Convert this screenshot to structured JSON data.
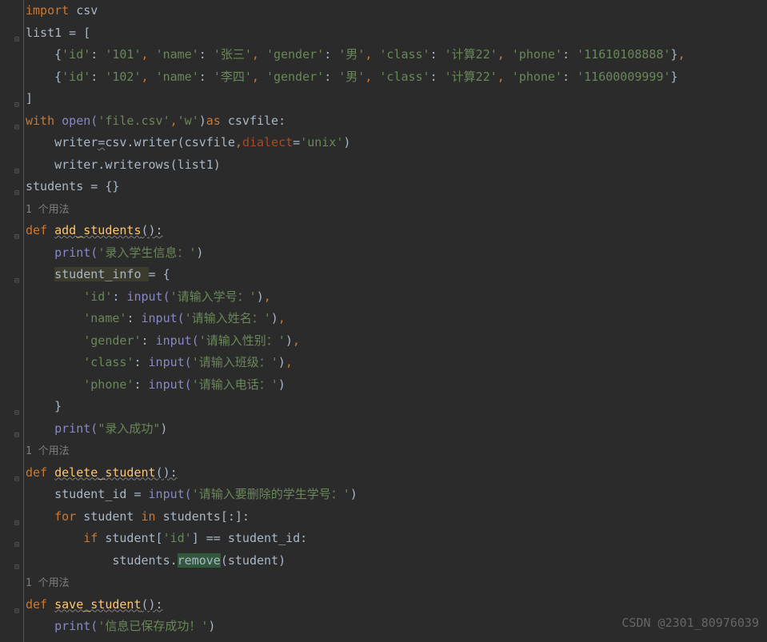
{
  "lines": [
    {
      "indent": 0,
      "segments": [
        {
          "t": "import ",
          "c": "kw"
        },
        {
          "t": "csv",
          "c": "fn"
        }
      ]
    },
    {
      "indent": 0,
      "segments": [
        {
          "t": "list1 = [",
          "c": "fn"
        }
      ]
    },
    {
      "indent": 1,
      "segments": [
        {
          "t": "{",
          "c": "fn"
        },
        {
          "t": "'id'",
          "c": "str"
        },
        {
          "t": ": ",
          "c": "fn"
        },
        {
          "t": "'101'",
          "c": "str"
        },
        {
          "t": ", ",
          "c": "kw"
        },
        {
          "t": "'name'",
          "c": "str"
        },
        {
          "t": ": ",
          "c": "fn"
        },
        {
          "t": "'张三'",
          "c": "str"
        },
        {
          "t": ", ",
          "c": "kw"
        },
        {
          "t": "'gender'",
          "c": "str"
        },
        {
          "t": ": ",
          "c": "fn"
        },
        {
          "t": "'男'",
          "c": "str"
        },
        {
          "t": ", ",
          "c": "kw"
        },
        {
          "t": "'class'",
          "c": "str"
        },
        {
          "t": ": ",
          "c": "fn"
        },
        {
          "t": "'计算22'",
          "c": "str"
        },
        {
          "t": ", ",
          "c": "kw"
        },
        {
          "t": "'phone'",
          "c": "str"
        },
        {
          "t": ": ",
          "c": "fn"
        },
        {
          "t": "'11610108888'",
          "c": "str"
        },
        {
          "t": "}",
          "c": "fn"
        },
        {
          "t": ",",
          "c": "kw"
        }
      ]
    },
    {
      "indent": 1,
      "segments": [
        {
          "t": "{",
          "c": "fn"
        },
        {
          "t": "'id'",
          "c": "str"
        },
        {
          "t": ": ",
          "c": "fn"
        },
        {
          "t": "'102'",
          "c": "str"
        },
        {
          "t": ", ",
          "c": "kw"
        },
        {
          "t": "'name'",
          "c": "str"
        },
        {
          "t": ": ",
          "c": "fn"
        },
        {
          "t": "'李四'",
          "c": "str"
        },
        {
          "t": ", ",
          "c": "kw"
        },
        {
          "t": "'gender'",
          "c": "str"
        },
        {
          "t": ": ",
          "c": "fn"
        },
        {
          "t": "'男'",
          "c": "str"
        },
        {
          "t": ", ",
          "c": "kw"
        },
        {
          "t": "'class'",
          "c": "str"
        },
        {
          "t": ": ",
          "c": "fn"
        },
        {
          "t": "'计算22'",
          "c": "str"
        },
        {
          "t": ", ",
          "c": "kw"
        },
        {
          "t": "'phone'",
          "c": "str"
        },
        {
          "t": ": ",
          "c": "fn"
        },
        {
          "t": "'11600009999'",
          "c": "str"
        },
        {
          "t": "}",
          "c": "fn"
        }
      ]
    },
    {
      "indent": 0,
      "segments": [
        {
          "t": "]",
          "c": "fn"
        }
      ]
    },
    {
      "indent": 0,
      "segments": [
        {
          "t": "with ",
          "c": "kw"
        },
        {
          "t": "open(",
          "c": "builtin"
        },
        {
          "t": "'file.csv'",
          "c": "str"
        },
        {
          "t": ",",
          "c": "kw"
        },
        {
          "t": "'w'",
          "c": "str"
        },
        {
          "t": ")",
          "c": "fn"
        },
        {
          "t": "as ",
          "c": "kw"
        },
        {
          "t": "csvfile:",
          "c": "fn"
        }
      ]
    },
    {
      "indent": 1,
      "segments": [
        {
          "t": "writer",
          "c": "fn"
        },
        {
          "t": "=",
          "c": "fn warn"
        },
        {
          "t": "csv.writer(csvfile",
          "c": "fn"
        },
        {
          "t": ",",
          "c": "kw"
        },
        {
          "t": "dialect",
          "c": "param"
        },
        {
          "t": "=",
          "c": "fn"
        },
        {
          "t": "'unix'",
          "c": "str"
        },
        {
          "t": ")",
          "c": "fn"
        }
      ]
    },
    {
      "indent": 1,
      "segments": [
        {
          "t": "writer.writerows(list1)",
          "c": "fn"
        }
      ]
    },
    {
      "indent": 0,
      "segments": [
        {
          "t": "students = {}",
          "c": "fn"
        }
      ]
    },
    {
      "indent": 0,
      "segments": [
        {
          "t": "1 个用法",
          "c": "comment"
        }
      ]
    },
    {
      "indent": 0,
      "segments": [
        {
          "t": "def ",
          "c": "kw"
        },
        {
          "t": "add_students",
          "c": "def warn"
        },
        {
          "t": "():",
          "c": "fn warn"
        }
      ]
    },
    {
      "indent": 1,
      "segments": [
        {
          "t": "print(",
          "c": "builtin"
        },
        {
          "t": "'录入学生信息：'",
          "c": "str"
        },
        {
          "t": ")",
          "c": "fn"
        }
      ]
    },
    {
      "indent": 1,
      "segments": [
        {
          "t": "student_info ",
          "c": "fn soft-warn"
        },
        {
          "t": "= {",
          "c": "fn"
        }
      ]
    },
    {
      "indent": 2,
      "segments": [
        {
          "t": "'id'",
          "c": "str"
        },
        {
          "t": ": ",
          "c": "fn"
        },
        {
          "t": "input(",
          "c": "builtin"
        },
        {
          "t": "'请输入学号：'",
          "c": "str"
        },
        {
          "t": ")",
          "c": "fn"
        },
        {
          "t": ",",
          "c": "kw"
        }
      ]
    },
    {
      "indent": 2,
      "segments": [
        {
          "t": "'name'",
          "c": "str"
        },
        {
          "t": ": ",
          "c": "fn"
        },
        {
          "t": "input(",
          "c": "builtin"
        },
        {
          "t": "'请输入姓名：'",
          "c": "str"
        },
        {
          "t": ")",
          "c": "fn"
        },
        {
          "t": ",",
          "c": "kw"
        }
      ]
    },
    {
      "indent": 2,
      "segments": [
        {
          "t": "'gender'",
          "c": "str"
        },
        {
          "t": ": ",
          "c": "fn"
        },
        {
          "t": "input(",
          "c": "builtin"
        },
        {
          "t": "'请输入性别：'",
          "c": "str"
        },
        {
          "t": ")",
          "c": "fn"
        },
        {
          "t": ",",
          "c": "kw"
        }
      ]
    },
    {
      "indent": 2,
      "segments": [
        {
          "t": "'class'",
          "c": "str"
        },
        {
          "t": ": ",
          "c": "fn"
        },
        {
          "t": "input(",
          "c": "builtin"
        },
        {
          "t": "'请输入班级：'",
          "c": "str"
        },
        {
          "t": ")",
          "c": "fn"
        },
        {
          "t": ",",
          "c": "kw"
        }
      ]
    },
    {
      "indent": 2,
      "segments": [
        {
          "t": "'phone'",
          "c": "str"
        },
        {
          "t": ": ",
          "c": "fn"
        },
        {
          "t": "input(",
          "c": "builtin"
        },
        {
          "t": "'请输入电话：'",
          "c": "str"
        },
        {
          "t": ")",
          "c": "fn"
        }
      ]
    },
    {
      "indent": 1,
      "segments": [
        {
          "t": "}",
          "c": "fn"
        }
      ]
    },
    {
      "indent": 1,
      "segments": [
        {
          "t": "print(",
          "c": "builtin"
        },
        {
          "t": "\"录入成功\"",
          "c": "str"
        },
        {
          "t": ")",
          "c": "fn"
        }
      ]
    },
    {
      "indent": 0,
      "segments": [
        {
          "t": "1 个用法",
          "c": "comment"
        }
      ]
    },
    {
      "indent": 0,
      "segments": [
        {
          "t": "def ",
          "c": "kw"
        },
        {
          "t": "delete_student",
          "c": "def warn"
        },
        {
          "t": "():",
          "c": "fn warn"
        }
      ]
    },
    {
      "indent": 1,
      "segments": [
        {
          "t": "student_id = ",
          "c": "fn"
        },
        {
          "t": "input(",
          "c": "builtin"
        },
        {
          "t": "'请输入要删除的学生学号：'",
          "c": "str"
        },
        {
          "t": ")",
          "c": "fn"
        }
      ]
    },
    {
      "indent": 1,
      "segments": [
        {
          "t": "for ",
          "c": "kw"
        },
        {
          "t": "student ",
          "c": "fn"
        },
        {
          "t": "in ",
          "c": "kw"
        },
        {
          "t": "students[:]:",
          "c": "fn"
        }
      ]
    },
    {
      "indent": 2,
      "segments": [
        {
          "t": "if ",
          "c": "kw"
        },
        {
          "t": "student[",
          "c": "fn"
        },
        {
          "t": "'id'",
          "c": "str"
        },
        {
          "t": "] == student_id:",
          "c": "fn"
        }
      ]
    },
    {
      "indent": 3,
      "segments": [
        {
          "t": "students.",
          "c": "fn"
        },
        {
          "t": "remove",
          "c": "fn hl"
        },
        {
          "t": "(student)",
          "c": "fn"
        }
      ]
    },
    {
      "indent": 0,
      "segments": [
        {
          "t": "1 个用法",
          "c": "comment"
        }
      ]
    },
    {
      "indent": 0,
      "segments": [
        {
          "t": "def ",
          "c": "kw"
        },
        {
          "t": "save_student",
          "c": "def warn"
        },
        {
          "t": "():",
          "c": "fn warn"
        }
      ]
    },
    {
      "indent": 1,
      "segments": [
        {
          "t": "print(",
          "c": "builtin"
        },
        {
          "t": "'信息已保存成功！'",
          "c": "str"
        },
        {
          "t": ")",
          "c": "fn"
        }
      ]
    }
  ],
  "folds": [
    1,
    4,
    5,
    7,
    8,
    10,
    12,
    18,
    19,
    21,
    23,
    24,
    25,
    27
  ],
  "watermark": "CSDN @2301_80976039"
}
